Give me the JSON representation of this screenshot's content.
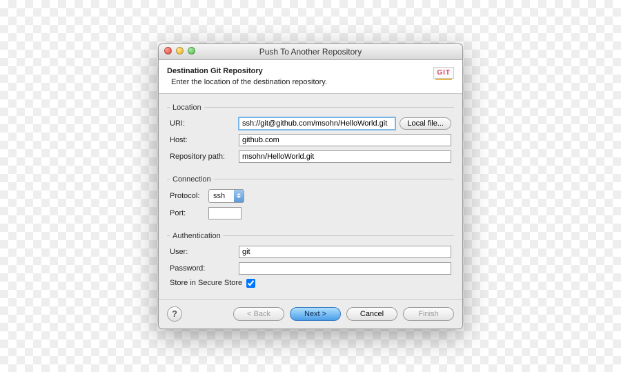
{
  "window": {
    "title": "Push To Another Repository"
  },
  "header": {
    "title": "Destination Git Repository",
    "subtitle": "Enter the location of the destination repository.",
    "icon_label": "GIT"
  },
  "location": {
    "legend": "Location",
    "uri_label": "URI:",
    "uri_value": "ssh://git@github.com/msohn/HelloWorld.git",
    "local_file_btn": "Local file...",
    "host_label": "Host:",
    "host_value": "github.com",
    "repo_path_label": "Repository path:",
    "repo_path_value": "msohn/HelloWorld.git"
  },
  "connection": {
    "legend": "Connection",
    "protocol_label": "Protocol:",
    "protocol_value": "ssh",
    "port_label": "Port:",
    "port_value": ""
  },
  "auth": {
    "legend": "Authentication",
    "user_label": "User:",
    "user_value": "git",
    "password_label": "Password:",
    "password_value": "",
    "store_label": "Store in Secure Store",
    "store_checked": true
  },
  "footer": {
    "back": "< Back",
    "next": "Next >",
    "cancel": "Cancel",
    "finish": "Finish"
  }
}
